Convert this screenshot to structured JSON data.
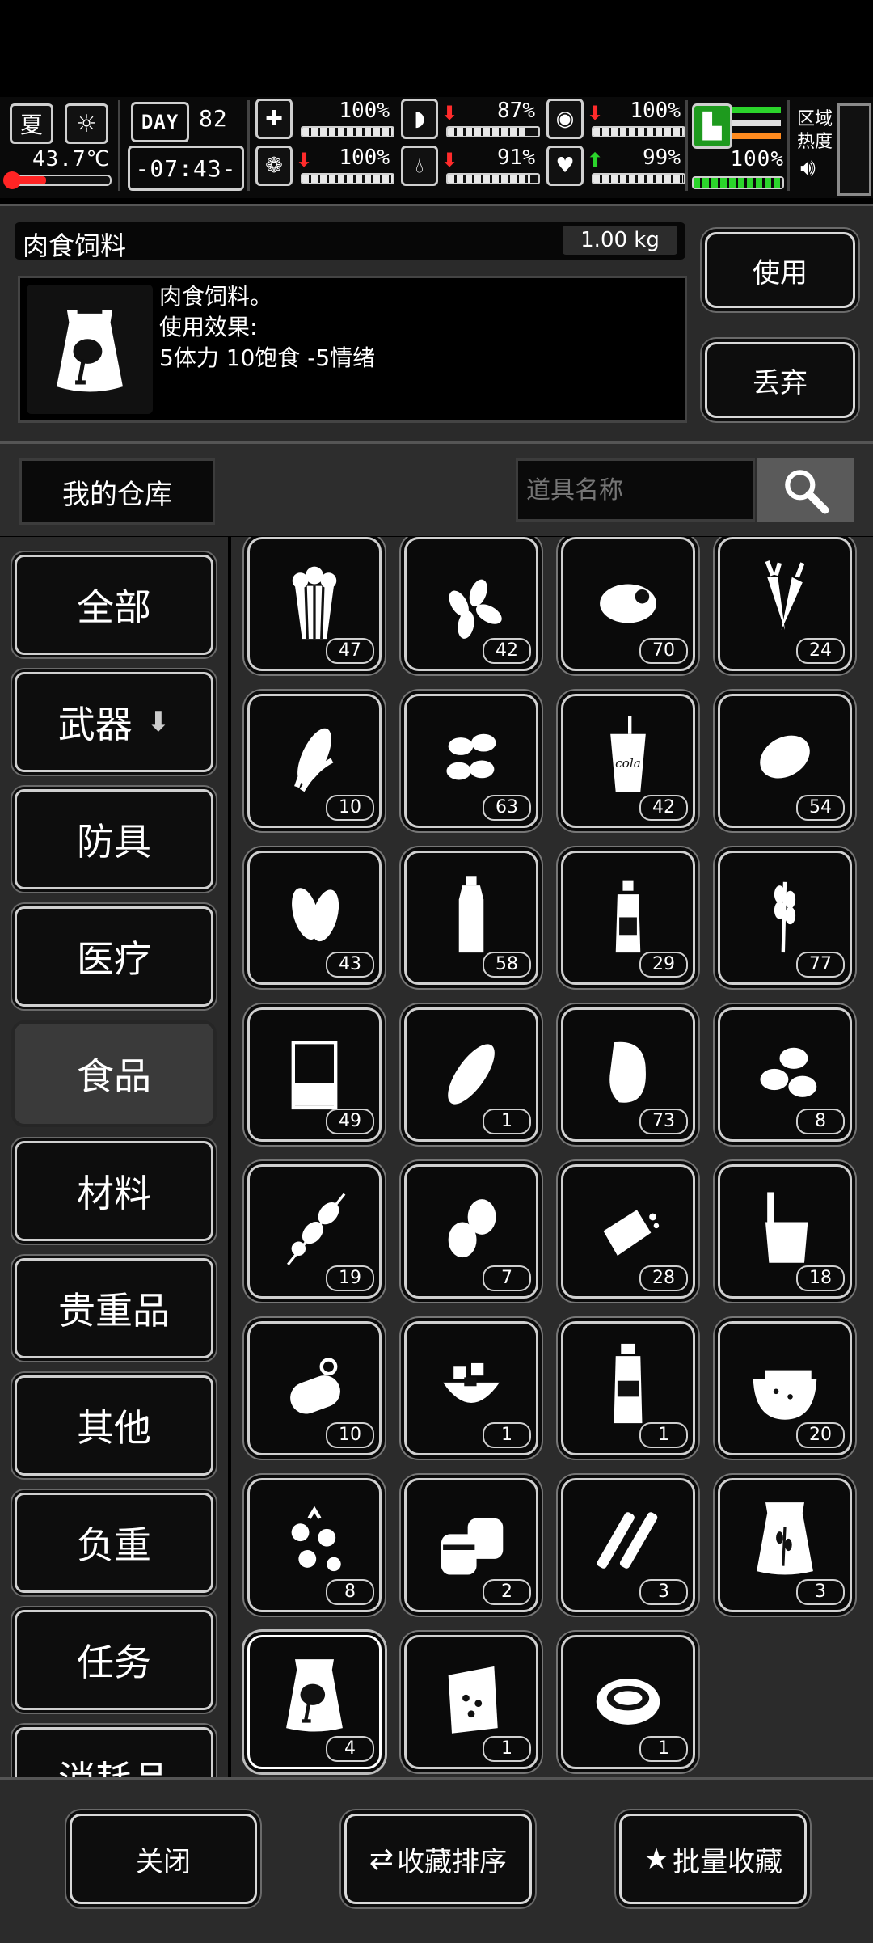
{
  "status": {
    "season": "夏",
    "temperature": "43.7℃",
    "day_label": "DAY",
    "day_number": "82",
    "clock": "-07:43-",
    "stats": [
      {
        "id": "health",
        "icon": "medkit-icon",
        "pct": "100%",
        "level": 1.0,
        "arrow": ""
      },
      {
        "id": "hunger",
        "icon": "stomach-icon",
        "pct": "87%",
        "level": 0.87,
        "arrow": "down"
      },
      {
        "id": "stamina",
        "icon": "capsule-icon",
        "pct": "100%",
        "level": 1.0,
        "arrow": "down"
      },
      {
        "id": "mood",
        "icon": "brain-icon",
        "pct": "100%",
        "level": 1.0,
        "arrow": "down"
      },
      {
        "id": "thirst",
        "icon": "water-drop-icon",
        "pct": "91%",
        "level": 0.91,
        "arrow": "down"
      },
      {
        "id": "heart",
        "icon": "heart-icon",
        "pct": "99%",
        "level": 0.99,
        "arrow": "up"
      }
    ],
    "speed_pct": "100%",
    "zone_label": "区域\n热度"
  },
  "item": {
    "name": "肉食饲料",
    "weight": "1.00 kg",
    "desc_line1": "肉食饲料。",
    "desc_line2": "使用效果:",
    "desc_line3": "5体力 10饱食 -5情绪",
    "icon": "meat-feed-bag-icon"
  },
  "actions": {
    "use": "使用",
    "discard": "丢弃"
  },
  "warehouse": {
    "title": "我的仓库",
    "search_placeholder": "道具名称"
  },
  "categories": [
    "全部",
    "武器",
    "防具",
    "医疗",
    "食品",
    "材料",
    "贵重品",
    "其他",
    "负重",
    "任务",
    "消耗品"
  ],
  "active_category": "食品",
  "items": [
    {
      "icon": "popcorn-icon",
      "qty": "47"
    },
    {
      "icon": "seeds-icon",
      "qty": "42"
    },
    {
      "icon": "raw-chicken-icon",
      "qty": "70"
    },
    {
      "icon": "carrot-icon",
      "qty": "24"
    },
    {
      "icon": "corn-icon",
      "qty": "10"
    },
    {
      "icon": "nuts-icon",
      "qty": "63"
    },
    {
      "icon": "cola-cup-icon",
      "qty": "42"
    },
    {
      "icon": "potato-icon",
      "qty": "54"
    },
    {
      "icon": "leaves-icon",
      "qty": "43"
    },
    {
      "icon": "water-bottle-icon",
      "qty": "58"
    },
    {
      "icon": "small-bottle-icon",
      "qty": "29"
    },
    {
      "icon": "wheat-icon",
      "qty": "77"
    },
    {
      "icon": "beaker-icon",
      "qty": "49"
    },
    {
      "icon": "bread-icon",
      "qty": "1"
    },
    {
      "icon": "steak-icon",
      "qty": "73"
    },
    {
      "icon": "coffee-beans-icon",
      "qty": "8"
    },
    {
      "icon": "skewer-icon",
      "qty": "19"
    },
    {
      "icon": "eggs-icon",
      "qty": "7"
    },
    {
      "icon": "cracker-icon",
      "qty": "28"
    },
    {
      "icon": "ice-cream-tub-icon",
      "qty": "18"
    },
    {
      "icon": "sardine-can-icon",
      "qty": "10"
    },
    {
      "icon": "salad-bowl-icon",
      "qty": "1"
    },
    {
      "icon": "sauce-bottle-icon",
      "qty": "1"
    },
    {
      "icon": "watermelon-icon",
      "qty": "20"
    },
    {
      "icon": "berries-icon",
      "qty": "8"
    },
    {
      "icon": "cans-icon",
      "qty": "2"
    },
    {
      "icon": "sticks-icon",
      "qty": "3"
    },
    {
      "icon": "grain-bag-icon",
      "qty": "3"
    },
    {
      "icon": "meat-feed-bag-icon",
      "qty": "4"
    },
    {
      "icon": "snack-bag-icon",
      "qty": "1"
    },
    {
      "icon": "soup-bowl-icon",
      "qty": "1"
    }
  ],
  "footer": {
    "close": "关闭",
    "sort": "收藏排序",
    "batch": "批量收藏"
  }
}
